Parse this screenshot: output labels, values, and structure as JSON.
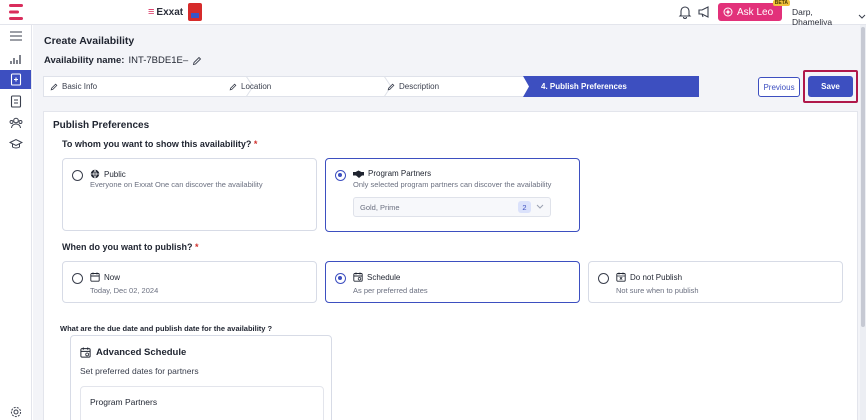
{
  "header": {
    "brand": "Exxat",
    "ask_leo": "Ask Leo",
    "ask_leo_badge": "BETA",
    "user": "Darp, Dhameliya"
  },
  "page": {
    "title": "Create Availability",
    "name_label": "Availability name:",
    "name_value": "INT-7BDE1E–"
  },
  "stepper": {
    "steps": [
      {
        "label": "Basic Info"
      },
      {
        "label": "Location"
      },
      {
        "label": "Description"
      },
      {
        "label": "4.  Publish Preferences"
      }
    ]
  },
  "actions": {
    "previous": "Previous",
    "save": "Save"
  },
  "publish": {
    "section_title": "Publish Preferences",
    "q_who": "To whom you want to show this availability?",
    "q_when": "When do you want to publish?",
    "required_mark": "*",
    "who_options": [
      {
        "title": "Public",
        "subtitle": "Everyone on Exxat One can discover the availability",
        "selected": false
      },
      {
        "title": "Program Partners",
        "subtitle": "Only selected program partners can discover the availability",
        "selected": true
      }
    ],
    "partners_select": {
      "value": "Gold, Prime",
      "count": "2"
    },
    "when_options": [
      {
        "title": "Now",
        "subtitle": "Today, Dec 02, 2024",
        "selected": false
      },
      {
        "title": "Schedule",
        "subtitle": "As per preferred dates",
        "selected": true
      },
      {
        "title": "Do not Publish",
        "subtitle": "Not sure when to publish",
        "selected": false
      }
    ],
    "q_dates": "What are the due date and publish date for the availability ?",
    "advanced": {
      "title": "Advanced Schedule",
      "subtitle": "Set preferred dates for partners",
      "inner_title": "Program Partners"
    }
  },
  "colors": {
    "primary": "#3d4fc0",
    "brand_pink": "#e2317a",
    "highlight": "#b0184a"
  }
}
